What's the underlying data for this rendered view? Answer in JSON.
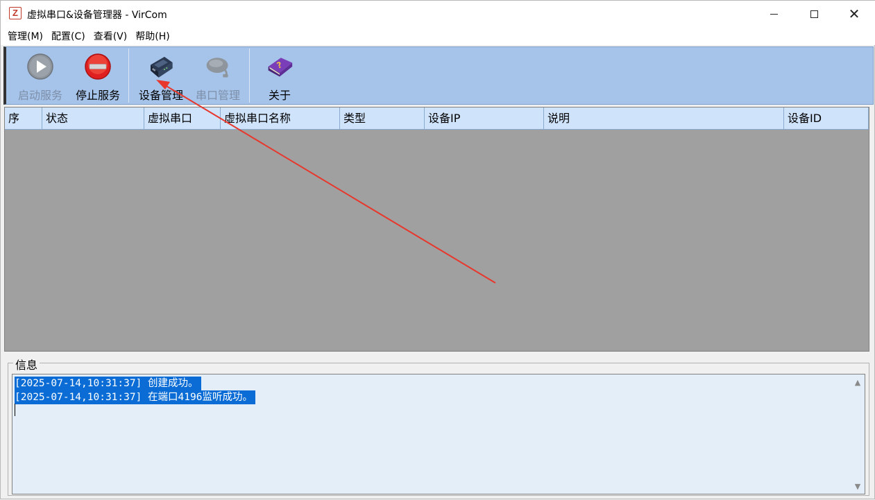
{
  "window": {
    "title": "虚拟串口&设备管理器 - VirCom",
    "icon_letter": "Z"
  },
  "menu": [
    {
      "label": "管理(M)"
    },
    {
      "label": "配置(C)"
    },
    {
      "label": "查看(V)"
    },
    {
      "label": "帮助(H)"
    }
  ],
  "toolbar": {
    "start_service": {
      "label": "启动服务",
      "enabled": false,
      "icon": "play-icon"
    },
    "stop_service": {
      "label": "停止服务",
      "enabled": true,
      "icon": "stop-icon"
    },
    "device_manage": {
      "label": "设备管理",
      "enabled": true,
      "icon": "device-icon"
    },
    "port_manage": {
      "label": "串口管理",
      "enabled": false,
      "icon": "port-icon"
    },
    "about": {
      "label": "关于",
      "enabled": true,
      "icon": "help-book-icon"
    }
  },
  "table": {
    "columns": [
      "序",
      "状态",
      "虚拟串口",
      "虚拟串口名称",
      "类型",
      "设备IP",
      "说明",
      "设备ID"
    ],
    "rows": []
  },
  "info": {
    "legend": "信息",
    "log": [
      "[2025-07-14,10:31:37] 创建成功。",
      "[2025-07-14,10:31:37] 在端口4196监听成功。"
    ]
  },
  "colors": {
    "toolbar_bg": "#a6c4ea",
    "header_bg": "#cfe3fb",
    "table_bg": "#a0a0a0",
    "selection": "#0a6cd4",
    "annotation_arrow": "#e8372c"
  }
}
